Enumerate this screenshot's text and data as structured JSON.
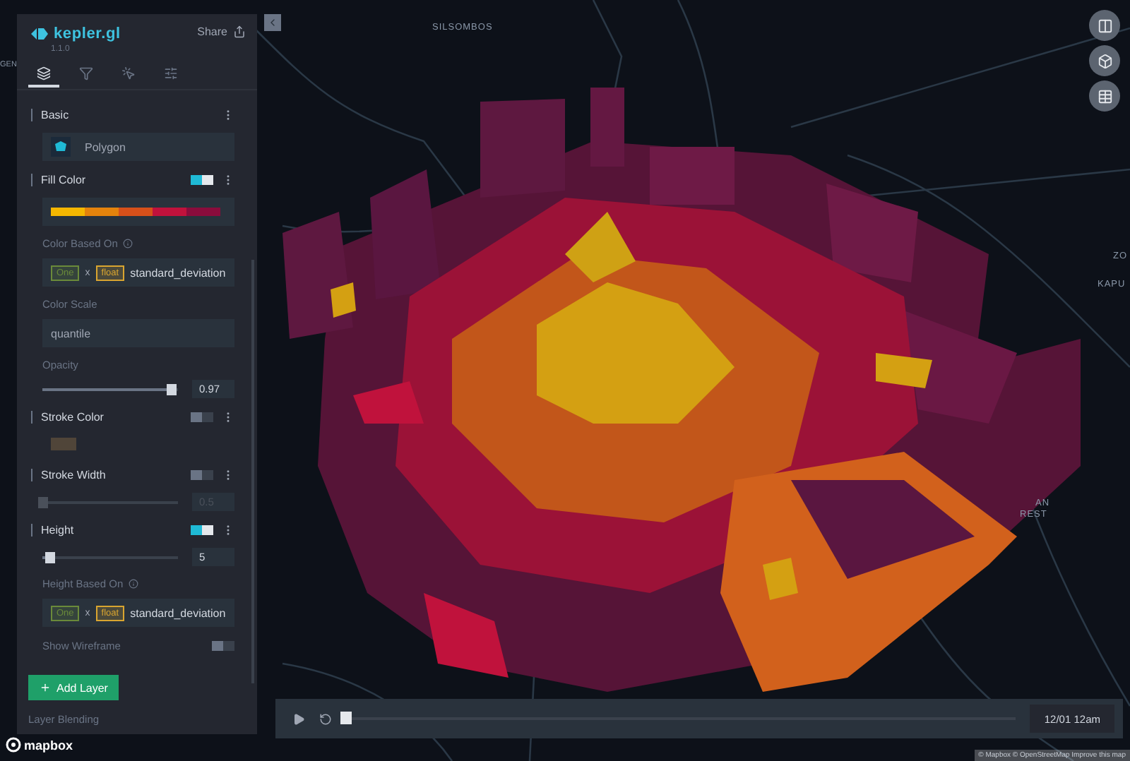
{
  "app": {
    "name": "kepler.gl",
    "version": "1.1.0",
    "share": "Share"
  },
  "tabs": [
    {
      "selected": true
    },
    {
      "selected": false
    },
    {
      "selected": false
    },
    {
      "selected": false
    }
  ],
  "basic": {
    "title": "Basic",
    "layer_type": "Polygon"
  },
  "fill_color": {
    "title": "Fill Color",
    "on": true,
    "based_on_label": "Color Based On",
    "based_on": {
      "tag": "One",
      "x": "x",
      "type": "float",
      "field": "standard_deviation"
    },
    "scale_label": "Color Scale",
    "scale": "quantile",
    "opacity_label": "Opacity",
    "opacity": {
      "level": 0.95,
      "reading": "0.97"
    }
  },
  "stroke_color": {
    "title": "Stroke Color",
    "on": false
  },
  "stroke_width": {
    "title": "Stroke Width",
    "on": false,
    "level": 0,
    "reading": "0.5"
  },
  "height": {
    "title": "Height",
    "on": true,
    "level": 0.05,
    "reading": "5",
    "based_on_label": "Height Based On",
    "based_on": {
      "tag": "One",
      "x": "x",
      "type": "float",
      "field": "standard_deviation"
    }
  },
  "wireframe": {
    "label": "Show Wireframe",
    "on": false
  },
  "add_layer": "Add Layer",
  "layer_blending": "Layer Blending",
  "map_labels": [
    "SILSOMBOS",
    "GEN",
    "ZO",
    "KAPU",
    "AN",
    "REST"
  ],
  "playback": {
    "level": 0,
    "time": "12/01 12am"
  },
  "logo": "mapbox",
  "attribution": "© Mapbox © OpenStreetMap Improve this map"
}
